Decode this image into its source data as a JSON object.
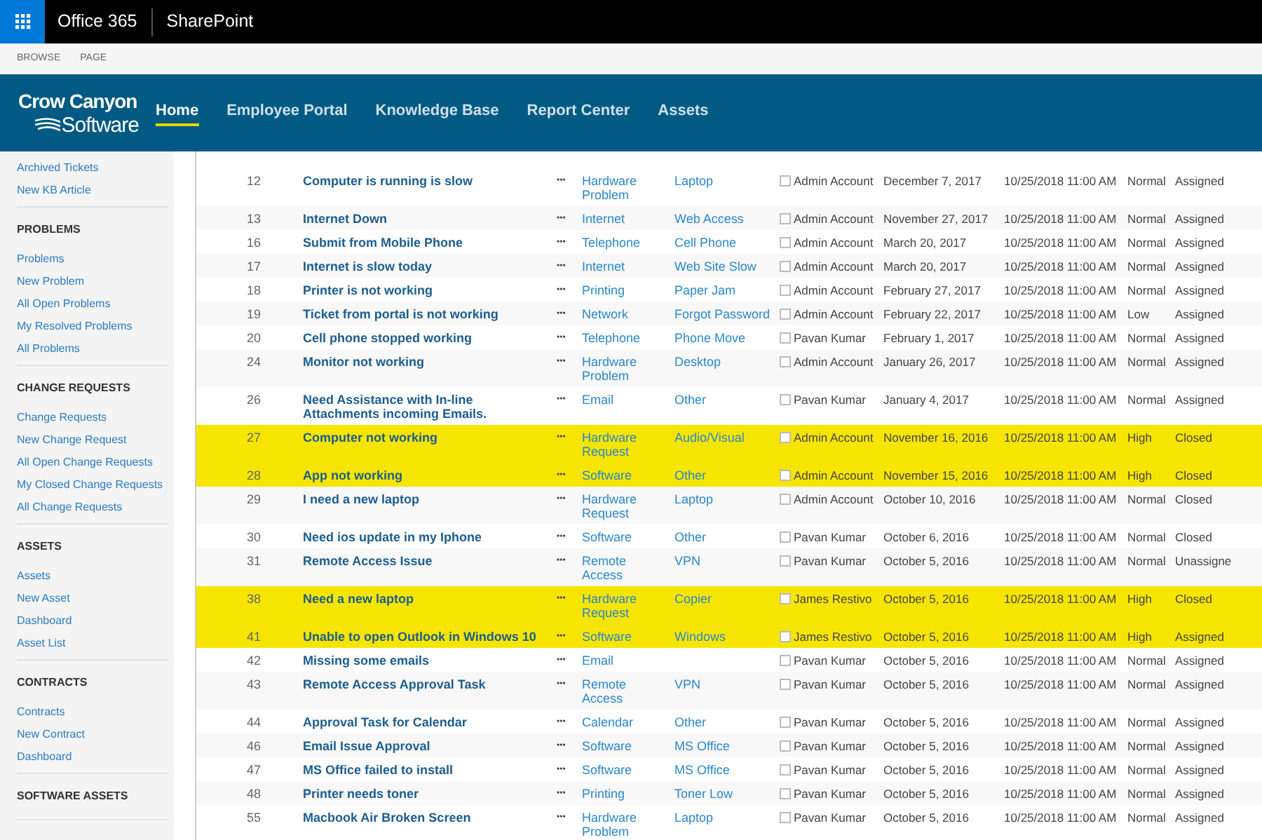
{
  "suite_bar": {
    "app_launcher": true,
    "brand": "Office 365",
    "app": "SharePoint"
  },
  "ribbon": {
    "tabs": [
      "BROWSE",
      "PAGE"
    ]
  },
  "header": {
    "logo": {
      "line_1": "Crow Canyon",
      "line_2": "Software"
    },
    "nav": [
      {
        "label": "Home",
        "selected": true
      },
      {
        "label": "Employee Portal",
        "selected": false
      },
      {
        "label": "Knowledge Base",
        "selected": false
      },
      {
        "label": "Report Center",
        "selected": false
      },
      {
        "label": "Assets",
        "selected": false
      }
    ]
  },
  "sidebar": {
    "sections": [
      {
        "items": [
          "Archived Tickets",
          "New KB Article"
        ]
      },
      {
        "heading": "PROBLEMS",
        "items": [
          "Problems",
          "New Problem",
          "All Open Problems",
          "My Resolved Problems",
          "All Problems"
        ]
      },
      {
        "heading": "CHANGE REQUESTS",
        "items": [
          "Change Requests",
          "New Change Request",
          "All Open Change Requests",
          "My Closed Change Requests",
          "All Change Requests"
        ]
      },
      {
        "heading": "ASSETS",
        "items": [
          "Assets",
          "New Asset",
          "Dashboard",
          "Asset List"
        ]
      },
      {
        "heading": "CONTRACTS",
        "items": [
          "Contracts",
          "New Contract",
          "Dashboard"
        ]
      },
      {
        "heading": "SOFTWARE ASSETS"
      }
    ]
  },
  "table": {
    "rows": [
      {
        "id": "12",
        "title": "Computer is running is slow",
        "menu": "•••",
        "category": "Hardware Problem",
        "subcategory": "Laptop",
        "checked": false,
        "assignee": "Admin Account",
        "date": "December 7, 2017",
        "due": "10/25/2018 11:00 AM",
        "priority": "Normal",
        "status": "Assigned",
        "highlighted": false
      },
      {
        "id": "13",
        "title": "Internet Down",
        "menu": "•••",
        "category": "Internet",
        "subcategory": "Web Access",
        "checked": false,
        "assignee": "Admin Account",
        "date": "November 27, 2017",
        "due": "10/25/2018 11:00 AM",
        "priority": "Normal",
        "status": "Assigned",
        "highlighted": false
      },
      {
        "id": "16",
        "title": "Submit from Mobile Phone",
        "menu": "•••",
        "category": "Telephone",
        "subcategory": "Cell Phone",
        "checked": false,
        "assignee": "Admin Account",
        "date": "March 20, 2017",
        "due": "10/25/2018 11:00 AM",
        "priority": "Normal",
        "status": "Assigned",
        "highlighted": false
      },
      {
        "id": "17",
        "title": "Internet is slow today",
        "menu": "•••",
        "category": "Internet",
        "subcategory": "Web Site Slow",
        "checked": false,
        "assignee": "Admin Account",
        "date": "March 20, 2017",
        "due": "10/25/2018 11:00 AM",
        "priority": "Normal",
        "status": "Assigned",
        "highlighted": false
      },
      {
        "id": "18",
        "title": "Printer is not working",
        "menu": "•••",
        "category": "Printing",
        "subcategory": "Paper Jam",
        "checked": false,
        "assignee": "Admin Account",
        "date": "February 27, 2017",
        "due": "10/25/2018 11:00 AM",
        "priority": "Normal",
        "status": "Assigned",
        "highlighted": false
      },
      {
        "id": "19",
        "title": "Ticket from portal is not working",
        "menu": "•••",
        "category": "Network",
        "subcategory": "Forgot Password",
        "checked": false,
        "assignee": "Admin Account",
        "date": "February 22, 2017",
        "due": "10/25/2018 11:00 AM",
        "priority": "Low",
        "status": "Assigned",
        "highlighted": false
      },
      {
        "id": "20",
        "title": "Cell phone stopped working",
        "menu": "•••",
        "category": "Telephone",
        "subcategory": "Phone Move",
        "checked": false,
        "assignee": "Pavan Kumar",
        "date": "February 1, 2017",
        "due": "10/25/2018 11:00 AM",
        "priority": "Normal",
        "status": "Assigned",
        "highlighted": false
      },
      {
        "id": "24",
        "title": "Monitor not working",
        "menu": "•••",
        "category": "Hardware Problem",
        "subcategory": "Desktop",
        "checked": false,
        "assignee": "Admin Account",
        "date": "January 26, 2017",
        "due": "10/25/2018 11:00 AM",
        "priority": "Normal",
        "status": "Assigned",
        "highlighted": false
      },
      {
        "id": "26",
        "title": "Need Assistance with In-line Attachments incoming Emails.",
        "menu": "•••",
        "category": "Email",
        "subcategory": "Other",
        "checked": false,
        "assignee": "Pavan Kumar",
        "date": "January 4, 2017",
        "due": "10/25/2018 11:00 AM",
        "priority": "Normal",
        "status": "Assigned",
        "highlighted": false
      },
      {
        "id": "27",
        "title": "Computer not working",
        "menu": "•••",
        "category": "Hardware Request",
        "subcategory": "Audio/Visual",
        "checked": false,
        "assignee": "Admin Account",
        "date": "November 16, 2016",
        "due": "10/25/2018 11:00 AM",
        "priority": "High",
        "status": "Closed",
        "highlighted": true
      },
      {
        "id": "28",
        "title": "App not working",
        "menu": "•••",
        "category": "Software",
        "subcategory": "Other",
        "checked": false,
        "assignee": "Admin Account",
        "date": "November 15, 2016",
        "due": "10/25/2018 11:00 AM",
        "priority": "High",
        "status": "Closed",
        "highlighted": true
      },
      {
        "id": "29",
        "title": "I need a new laptop",
        "menu": "•••",
        "category": "Hardware Request",
        "subcategory": "Laptop",
        "checked": false,
        "assignee": "Admin Account",
        "date": "October 10, 2016",
        "due": "10/25/2018 11:00 AM",
        "priority": "Normal",
        "status": "Closed",
        "highlighted": false
      },
      {
        "id": "30",
        "title": "Need ios update in my Iphone",
        "menu": "•••",
        "category": "Software",
        "subcategory": "Other",
        "checked": false,
        "assignee": "Pavan Kumar",
        "date": "October 6, 2016",
        "due": "10/25/2018 11:00 AM",
        "priority": "Normal",
        "status": "Closed",
        "highlighted": false
      },
      {
        "id": "31",
        "title": "Remote Access Issue",
        "menu": "•••",
        "category": "Remote Access",
        "subcategory": "VPN",
        "checked": false,
        "assignee": "Pavan Kumar",
        "date": "October 5, 2016",
        "due": "10/25/2018 11:00 AM",
        "priority": "Normal",
        "status": "Unassigne",
        "highlighted": false
      },
      {
        "id": "38",
        "title": "Need a new laptop",
        "menu": "•••",
        "category": "Hardware Request",
        "subcategory": "Copier",
        "checked": false,
        "assignee": "James Restivo",
        "date": "October 5, 2016",
        "due": "10/25/2018 11:00 AM",
        "priority": "High",
        "status": "Closed",
        "highlighted": true
      },
      {
        "id": "41",
        "title": "Unable to open Outlook in Windows 10",
        "menu": "•••",
        "category": "Software",
        "subcategory": "Windows",
        "checked": false,
        "assignee": "James Restivo",
        "date": "October 5, 2016",
        "due": "10/25/2018 11:00 AM",
        "priority": "High",
        "status": "Assigned",
        "highlighted": true
      },
      {
        "id": "42",
        "title": "Missing some emails",
        "menu": "•••",
        "category": "Email",
        "checked": false,
        "assignee": "Pavan Kumar",
        "date": "October 5, 2016",
        "due": "10/25/2018 11:00 AM",
        "priority": "Normal",
        "status": "Assigned",
        "highlighted": false
      },
      {
        "id": "43",
        "title": "Remote Access Approval Task",
        "menu": "•••",
        "category": "Remote Access",
        "subcategory": "VPN",
        "checked": false,
        "assignee": "Pavan Kumar",
        "date": "October 5, 2016",
        "due": "10/25/2018 11:00 AM",
        "priority": "Normal",
        "status": "Assigned",
        "highlighted": false
      },
      {
        "id": "44",
        "title": "Approval Task for Calendar",
        "menu": "•••",
        "category": "Calendar",
        "subcategory": "Other",
        "checked": false,
        "assignee": "Pavan Kumar",
        "date": "October 5, 2016",
        "due": "10/25/2018 11:00 AM",
        "priority": "Normal",
        "status": "Assigned",
        "highlighted": false
      },
      {
        "id": "46",
        "title": "Email Issue Approval",
        "menu": "•••",
        "category": "Software",
        "subcategory": "MS Office",
        "checked": false,
        "assignee": "Pavan Kumar",
        "date": "October 5, 2016",
        "due": "10/25/2018 11:00 AM",
        "priority": "Normal",
        "status": "Assigned",
        "highlighted": false
      },
      {
        "id": "47",
        "title": "MS Office failed to install",
        "menu": "•••",
        "category": "Software",
        "subcategory": "MS Office",
        "checked": false,
        "assignee": "Pavan Kumar",
        "date": "October 5, 2016",
        "due": "10/25/2018 11:00 AM",
        "priority": "Normal",
        "status": "Assigned",
        "highlighted": false
      },
      {
        "id": "48",
        "title": "Printer needs toner",
        "menu": "•••",
        "category": "Printing",
        "subcategory": "Toner Low",
        "checked": false,
        "assignee": "Pavan Kumar",
        "date": "October 5, 2016",
        "due": "10/25/2018 11:00 AM",
        "priority": "Normal",
        "status": "Assigned",
        "highlighted": false
      },
      {
        "id": "55",
        "title": "Macbook Air Broken Screen",
        "menu": "•••",
        "category": "Hardware Problem",
        "subcategory": "Laptop",
        "checked": false,
        "assignee": "Pavan Kumar",
        "date": "October 5, 2016",
        "due": "10/25/2018 11:00 AM",
        "priority": "Normal",
        "status": "Assigned",
        "highlighted": false
      }
    ]
  }
}
